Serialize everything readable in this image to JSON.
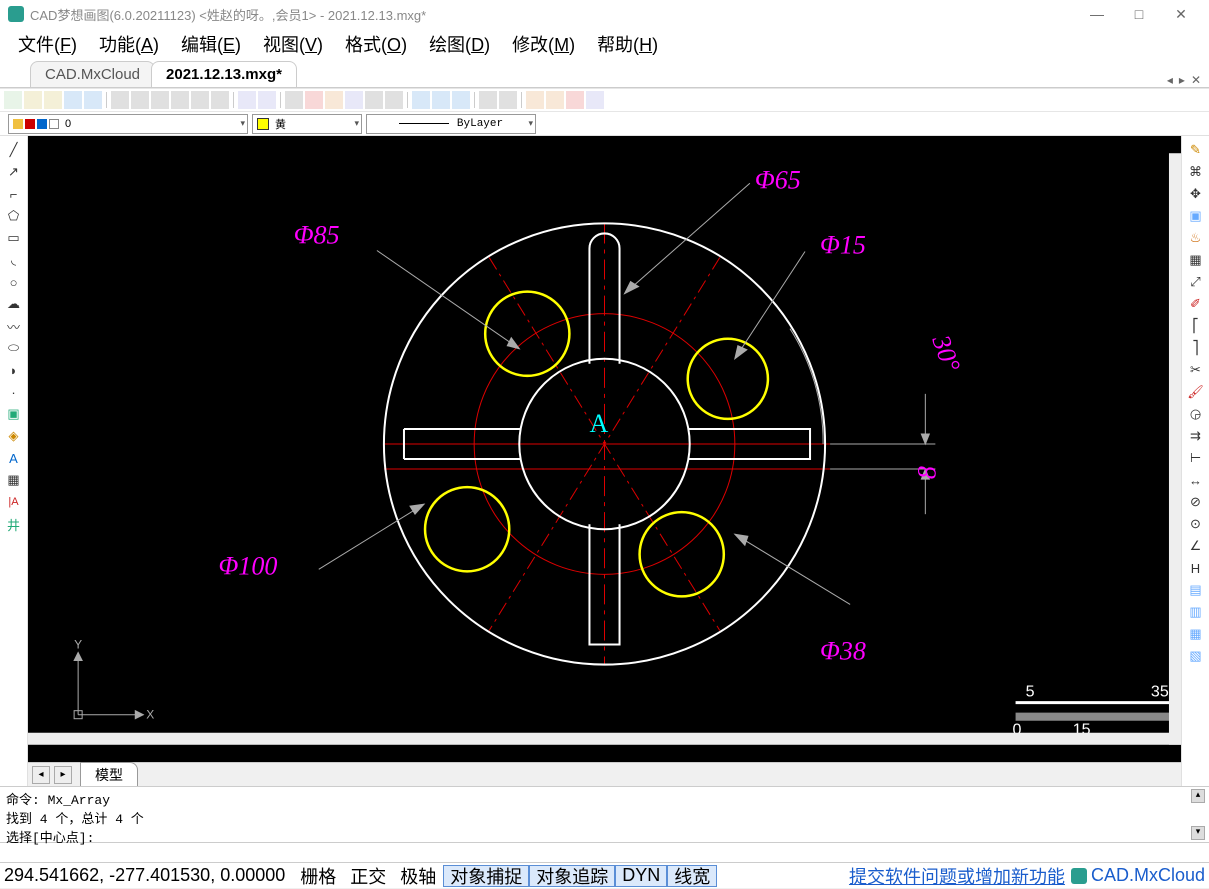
{
  "title": "CAD梦想画图(6.0.20211123) <姓赵的呀。,会员1> - 2021.12.13.mxg*",
  "menus": {
    "file": "文件(",
    "file_u": "F",
    "func": "功能(",
    "func_u": "A",
    "edit": "编辑(",
    "edit_u": "E",
    "view": "视图(",
    "view_u": "V",
    "fmt": "格式(",
    "fmt_u": "O",
    "draw": "绘图(",
    "draw_u": "D",
    "mod": "修改(",
    "mod_u": "M",
    "help": "帮助(",
    "help_u": "H"
  },
  "tabs": {
    "t1": "CAD.MxCloud",
    "t2": "2021.12.13.mxg*"
  },
  "layer_text": "0",
  "color_text": "黄",
  "linetype_text": "ByLayer",
  "model_tab": "模型",
  "cmd_l1": "命令: Mx_Array",
  "cmd_l2": "    找到 4 个，总计 4 个",
  "cmd_l3": "选择[中心点]:",
  "cmd_input": "",
  "status": {
    "coords": "294.541662,   -277.401530,   0.00000",
    "grid": "栅格",
    "ortho": "正交",
    "polar": "极轴",
    "osnap": "对象捕捉",
    "otrack": "对象追踪",
    "dyn": "DYN",
    "lw": "线宽",
    "link": "提交软件问题或增加新功能",
    "brand": "CAD.MxCloud"
  },
  "dim": {
    "d65": "Φ65",
    "d85": "Φ85",
    "d15": "Φ15",
    "ang30": "30°",
    "d100": "Φ100",
    "d38": "Φ38",
    "v8": "8",
    "a": "A"
  },
  "scale": {
    "l": "5",
    "r": "35",
    "lb": "0",
    "rb": "15"
  },
  "axes": {
    "x": "X",
    "y": "Y"
  }
}
